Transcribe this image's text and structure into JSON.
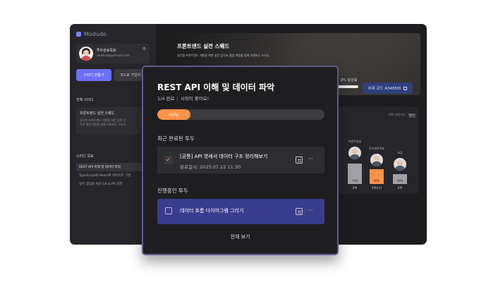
{
  "app": {
    "logo": "Modudo",
    "profile": {
      "name": "투두완료목표",
      "email": "abdhsdo@email.com"
    },
    "buttons": {
      "create_study": "스터디 만들기",
      "enter_code": "코드로 가입하기"
    },
    "all_study_heading": "전체 스터디",
    "study_card": {
      "title": "프론트엔드 실전 스웨드",
      "desc_line1": "실무형 프론트엔드 개발을 위한 실전 신",
      "desc_line2": "각과 협업 역량을 함께 키워보는 스터디."
    },
    "study_list_heading": "스터디 목표",
    "study_list": [
      "REST API 이해 및 데이터 파악",
      "TypeScript와 React로 데이터트 구현",
      "실무 협업을 위한 Git & PR 리뷰"
    ],
    "banner": {
      "title": "프론트엔드 실전 스웨드",
      "desc": "실무형 프론트엔드 개발을 위한 실전 감각과 협업 역량을 함께 키워보는 스터디.",
      "progress_text": "0% 달성률",
      "invite_label": "초대 코드 A3485f0"
    },
    "ranking": {
      "title": "랭킹",
      "more": "SSR 랭킹보드",
      "members": [
        {
          "name": "",
          "pct": "70%",
          "rank": "2위",
          "color": "#a0a0a6"
        },
        {
          "name": "프론트연습",
          "pct": "",
          "rank": "",
          "color": "#a0a0a6"
        },
        {
          "name": "투두완료목표",
          "pct": "50%",
          "rank": "3위(나)",
          "color": "#ff9249"
        },
        {
          "name": "코딩",
          "pct": "30%",
          "rank": "4위",
          "color": "#a0a0a6"
        }
      ]
    }
  },
  "modal": {
    "title": "REST API 이해 및 데이터 파악",
    "completed_count": "1/4 완료",
    "sep": "|",
    "cheer": "시작이 좋아요!",
    "progress": {
      "label": "20%",
      "value": 0.2
    },
    "recent_heading": "최근 완료된 투두",
    "done_item": {
      "title": "[공통] API 명세서 데이터 구조 정리해보기",
      "date": "완료일시: 2025.07.22 11:30",
      "more": "···"
    },
    "in_progress_heading": "진행중인 투두",
    "progress_item": {
      "title": "데이터 흐름 다이어그램 그리기",
      "more": "···"
    },
    "view_all": "전체 보기"
  },
  "colors": {
    "accent": "#ff9249",
    "primary": "#6c6ff2",
    "in_progress": "#393c8c"
  }
}
